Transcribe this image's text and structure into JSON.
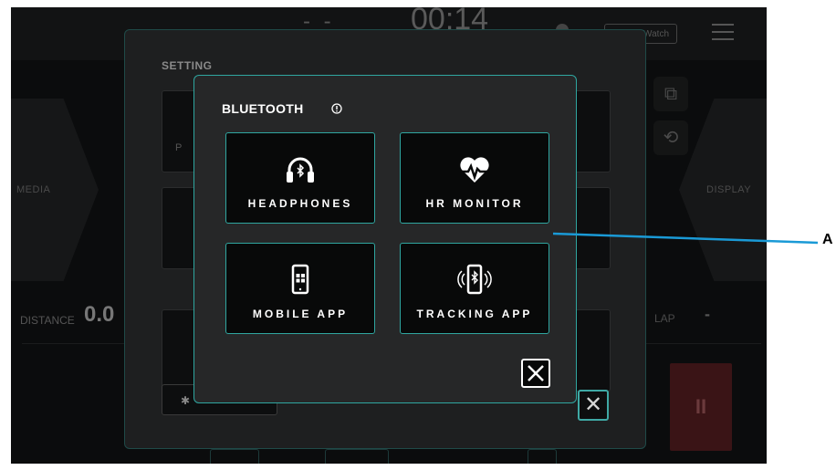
{
  "topbar": {
    "dashes": "- -",
    "timer": "00:14",
    "watch_label": "Watch"
  },
  "background": {
    "media_label": "MEDIA",
    "display_label": "DISPLAY",
    "distance_label": "DISTANCE",
    "distance_value": "0.0",
    "lap_label": "LAP",
    "lap_value": "-",
    "pause_label": "II"
  },
  "setting": {
    "title": "SETTING",
    "partial_tile_text": "P"
  },
  "bluetooth_modal": {
    "title": "BLUETOOTH",
    "tiles": [
      {
        "label": "HEADPHONES",
        "icon": "headphones-bluetooth-icon"
      },
      {
        "label": "HR MONITOR",
        "icon": "heart-rate-icon"
      },
      {
        "label": "MOBILE APP",
        "icon": "phone-app-icon"
      },
      {
        "label": "TRACKING APP",
        "icon": "phone-bluetooth-icon"
      }
    ],
    "close_icon": "close-icon"
  },
  "annotation": {
    "callout_letter": "A"
  },
  "colors": {
    "accent": "#2fa6a0",
    "panel": "#262728",
    "tile": "#080909",
    "pause": "#3a1416"
  }
}
